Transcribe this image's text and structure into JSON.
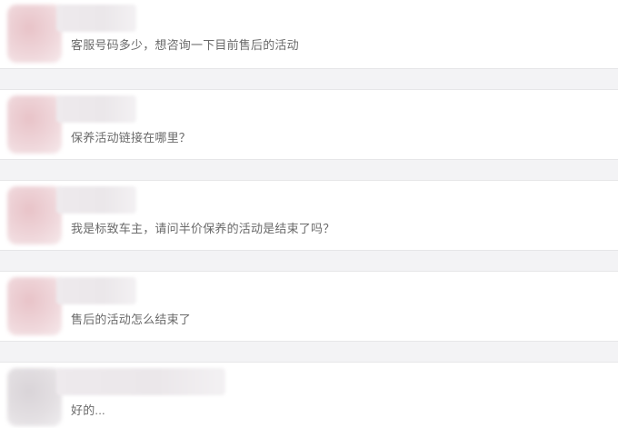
{
  "messages": [
    {
      "text": "客服号码多少，想咨询一下目前售后的活动"
    },
    {
      "text": "保养活动链接在哪里？"
    },
    {
      "text": "我是标致车主，请问半价保养的活动是结束了吗？"
    },
    {
      "text": "售后的活动怎么结束了"
    },
    {
      "text": "好的..."
    }
  ]
}
